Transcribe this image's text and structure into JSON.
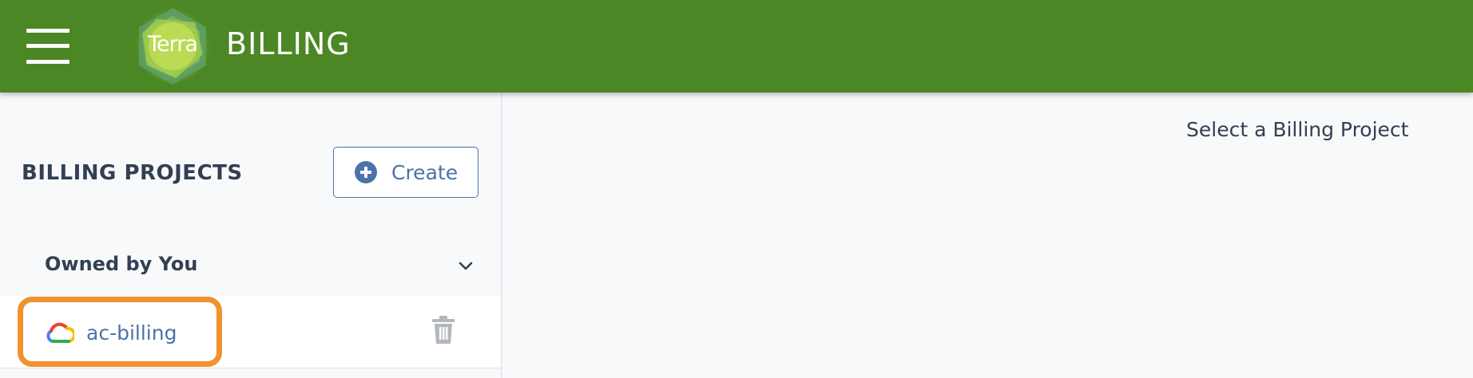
{
  "header": {
    "logo_text": "Terra",
    "title": "BILLING",
    "menu_icon": "hamburger-menu-icon",
    "colors": {
      "bar": "#4b8724"
    }
  },
  "sidebar": {
    "title": "BILLING PROJECTS",
    "create_button": {
      "label": "Create",
      "icon": "plus-circle-icon"
    },
    "sections": [
      {
        "label": "Owned by You",
        "icon": "chevron-down-icon",
        "projects": [
          {
            "name": "ac-billing",
            "icon": "google-cloud-icon",
            "action_icon": "trash-icon"
          }
        ]
      }
    ],
    "colors": {
      "accent": "#4d72aa",
      "highlight": "#f0922e"
    }
  },
  "main": {
    "placeholder": "Select a Billing Project"
  }
}
